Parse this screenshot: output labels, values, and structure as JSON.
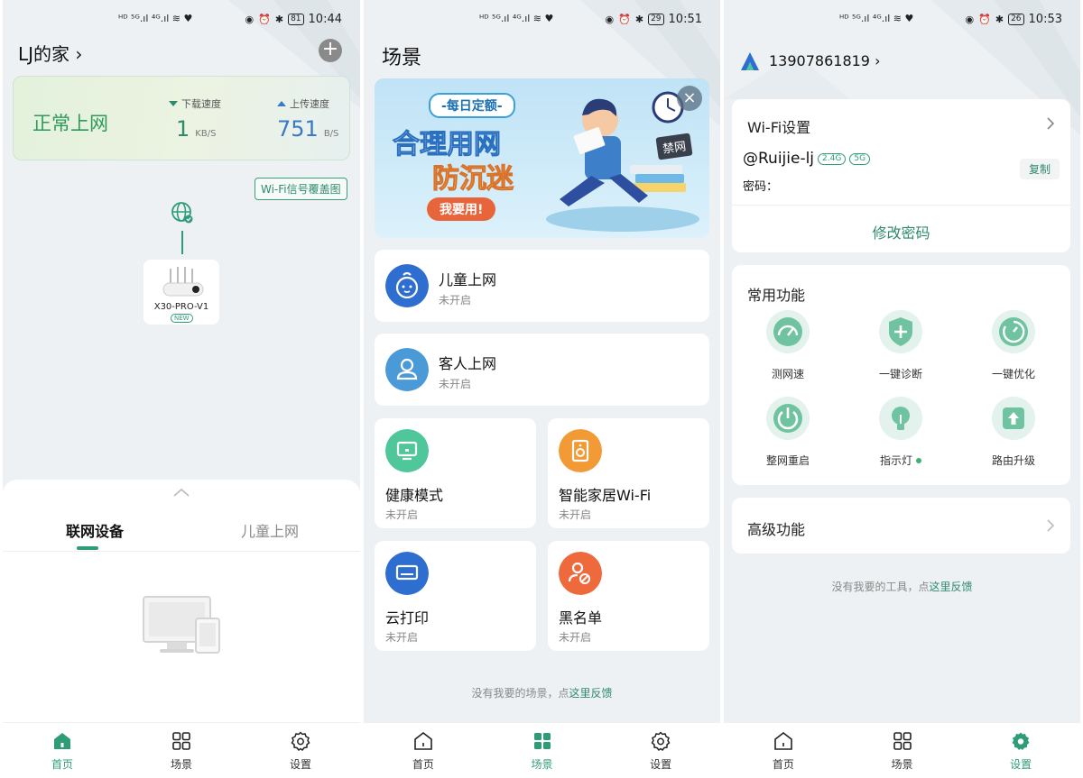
{
  "status_bar": {
    "s1": {
      "left_glyphs": "ᴴᴰ ⁵ᴳ.ıl ⁴ᴳ.ıl ≋ ♥",
      "battery": "81",
      "time": "10:44"
    },
    "s2": {
      "left_glyphs": "ᴴᴰ ⁵ᴳ.ıl ⁴ᴳ.ıl ≋ ♥",
      "battery": "29",
      "time": "10:51"
    },
    "s3": {
      "left_glyphs": "ᴴᴰ ⁵ᴳ.ıl ⁴ᴳ.ıl ≋ ♥",
      "battery": "26",
      "time": "10:53"
    }
  },
  "home": {
    "title": "LJ的家 ›",
    "add_label": "+",
    "status": "正常上网",
    "download": {
      "label": "下载速度",
      "value": "1",
      "unit": "KB/S"
    },
    "upload": {
      "label": "上传速度",
      "value": "751",
      "unit": "B/S"
    },
    "wifi_map": "Wi-Fi信号覆盖图",
    "router": {
      "name": "X30-PRO-V1",
      "badge": "NEW"
    },
    "tabs": [
      {
        "label": "联网设备"
      },
      {
        "label": "儿童上网"
      }
    ]
  },
  "scenes": {
    "title": "场景",
    "banner": {
      "pill": "-每日定额-",
      "line1": "合理用网",
      "line2": "防沉迷",
      "button": "我要用!",
      "tag": "禁网",
      "close": "×"
    },
    "cards": [
      {
        "name": "儿童上网",
        "status": "未开启"
      },
      {
        "name": "客人上网",
        "status": "未开启"
      },
      {
        "name": "健康模式",
        "status": "未开启"
      },
      {
        "name": "智能家居Wi-Fi",
        "status": "未开启"
      },
      {
        "name": "云打印",
        "status": "未开启"
      },
      {
        "name": "黑名单",
        "status": "未开启"
      }
    ],
    "footer_prefix": "没有我要的场景，点",
    "footer_link": "这里反馈"
  },
  "settings": {
    "account": "13907861819 ›",
    "wifi_header": "Wi-Fi设置",
    "ssid": "@Ruijie-lj",
    "band_24": "2.4G",
    "band_5": "5G",
    "password_label": "密码：",
    "copy": "复制",
    "change_password": "修改密码",
    "common_title": "常用功能",
    "features": [
      {
        "label": "测网速"
      },
      {
        "label": "一键诊断"
      },
      {
        "label": "一键优化"
      },
      {
        "label": "整网重启"
      },
      {
        "label": "指示灯"
      },
      {
        "label": "路由升级"
      }
    ],
    "advanced": "高级功能",
    "footer_prefix": "没有我要的工具，点",
    "footer_link": "这里反馈"
  },
  "nav": {
    "home": "首页",
    "scene": "场景",
    "settings": "设置"
  },
  "colors": {
    "accent": "#2f9c78",
    "status_green": "#2d9a5c",
    "upload_blue": "#3a78c8"
  }
}
